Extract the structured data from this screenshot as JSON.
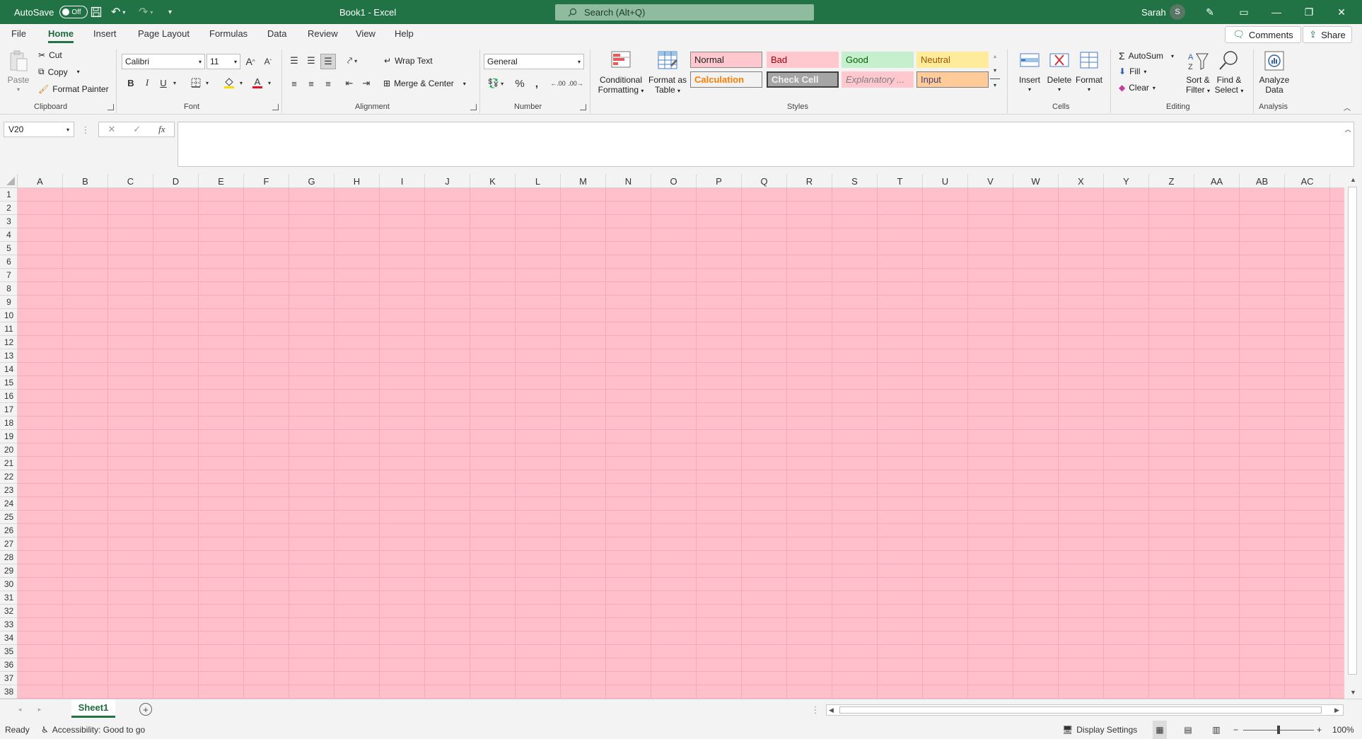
{
  "app": {
    "autosave_label": "AutoSave",
    "autosave_state": "Off",
    "title": "Book1  -  Excel",
    "search_placeholder": "Search (Alt+Q)",
    "user_name": "Sarah",
    "user_initial": "S"
  },
  "tabs": [
    "File",
    "Home",
    "Insert",
    "Page Layout",
    "Formulas",
    "Data",
    "Review",
    "View",
    "Help"
  ],
  "active_tab": "Home",
  "actions": {
    "comments": "Comments",
    "share": "Share"
  },
  "clipboard": {
    "paste": "Paste",
    "cut": "Cut",
    "copy": "Copy",
    "format_painter": "Format Painter",
    "group": "Clipboard"
  },
  "font": {
    "name": "Calibri",
    "size": "11",
    "group": "Font",
    "font_color": "#e81123",
    "fill_color": "#ffd800"
  },
  "alignment": {
    "wrap_text": "Wrap Text",
    "merge_center": "Merge & Center",
    "group": "Alignment"
  },
  "number": {
    "format": "General",
    "group": "Number"
  },
  "styles": {
    "conditional_formatting": [
      "Conditional",
      "Formatting"
    ],
    "format_as_table": [
      "Format as",
      "Table"
    ],
    "cells": [
      {
        "label": "Normal",
        "bg": "#ffc7ce",
        "color": "#222222",
        "border": "#8a8a8a"
      },
      {
        "label": "Bad",
        "bg": "#ffc7ce",
        "color": "#9c0006",
        "border": "transparent"
      },
      {
        "label": "Good",
        "bg": "#c6efce",
        "color": "#006100",
        "border": "transparent"
      },
      {
        "label": "Neutral",
        "bg": "#ffeb9c",
        "color": "#9c5700",
        "border": "transparent"
      },
      {
        "label": "Calculation",
        "bg": "#f2f2f2",
        "color": "#fa7d00",
        "border": "#7f7f7f"
      },
      {
        "label": "Check Cell",
        "bg": "#a5a5a5",
        "color": "#f2f2f2",
        "border": "#3f3f3f"
      },
      {
        "label": "Explanatory ...",
        "bg": "#ffc7ce",
        "color": "#7f7f7f",
        "border": "transparent"
      },
      {
        "label": "Input",
        "bg": "#ffcc99",
        "color": "#3f3f76",
        "border": "#7f7f7f"
      }
    ],
    "group": "Styles"
  },
  "cells_group": {
    "insert": "Insert",
    "delete": "Delete",
    "format": "Format",
    "group": "Cells"
  },
  "editing": {
    "autosum": "AutoSum",
    "fill": "Fill",
    "clear": "Clear",
    "sort_filter": [
      "Sort &",
      "Filter"
    ],
    "find_select": [
      "Find &",
      "Select"
    ],
    "group": "Editing"
  },
  "analysis": {
    "analyze_data": [
      "Analyze",
      "Data"
    ],
    "group": "Analysis"
  },
  "formula_bar": {
    "name_box": "V20",
    "fx": "fx",
    "value": ""
  },
  "grid": {
    "columns": [
      "A",
      "B",
      "C",
      "D",
      "E",
      "F",
      "G",
      "H",
      "I",
      "J",
      "K",
      "L",
      "M",
      "N",
      "O",
      "P",
      "Q",
      "R",
      "S",
      "T",
      "U",
      "V",
      "W",
      "X",
      "Y",
      "Z",
      "AA",
      "AB",
      "AC"
    ],
    "rows": [
      "1",
      "2",
      "3",
      "4",
      "5",
      "6",
      "7",
      "8",
      "9",
      "10",
      "11",
      "12",
      "13",
      "14",
      "15",
      "16",
      "17",
      "18",
      "19",
      "20",
      "21",
      "22",
      "23",
      "24",
      "25",
      "26",
      "27",
      "28",
      "29",
      "30",
      "31",
      "32",
      "33",
      "34",
      "35",
      "36",
      "37",
      "38"
    ],
    "cell_fill": "#ffc0cb",
    "gridline_color": "#f4a8b8"
  },
  "sheets": [
    "Sheet1"
  ],
  "status": {
    "ready": "Ready",
    "accessibility": "Accessibility: Good to go",
    "display_settings": "Display Settings",
    "zoom": "100%"
  },
  "colors": {
    "brand": "#217346",
    "accent_text": "#1d6b3e"
  }
}
